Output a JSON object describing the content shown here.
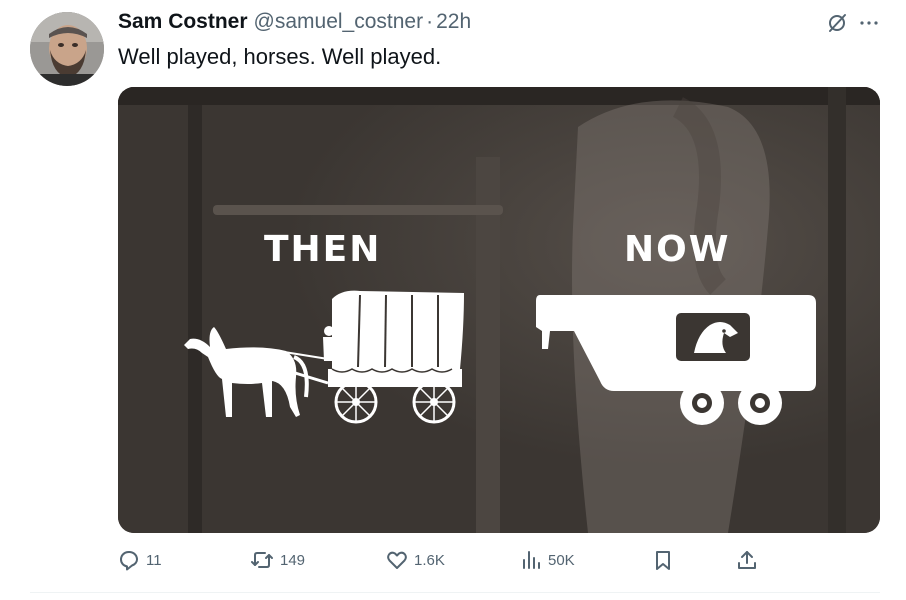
{
  "tweet": {
    "author_name": "Sam Costner",
    "handle": "@samuel_costner",
    "separator": "·",
    "time": "22h",
    "text": "Well played, horses. Well played.",
    "avatar_icon": "avatar-photo",
    "grok_icon": "grok-icon",
    "more_icon": "more-icon",
    "more_label": "···"
  },
  "media": {
    "label_then": "THEN",
    "label_now": "NOW",
    "then_icon": "horse-wagon-icon",
    "now_icon": "horse-trailer-icon",
    "background_color": "#3b3632"
  },
  "actions": {
    "reply": {
      "icon": "reply-icon",
      "count": "11"
    },
    "retweet": {
      "icon": "retweet-icon",
      "count": "149"
    },
    "like": {
      "icon": "heart-icon",
      "count": "1.6K"
    },
    "views": {
      "icon": "views-icon",
      "count": "50K"
    },
    "bookmark": {
      "icon": "bookmark-icon"
    },
    "share": {
      "icon": "share-icon"
    }
  },
  "colors": {
    "text_primary": "#0f1419",
    "text_secondary": "#536471",
    "divider": "#eff3f4"
  }
}
